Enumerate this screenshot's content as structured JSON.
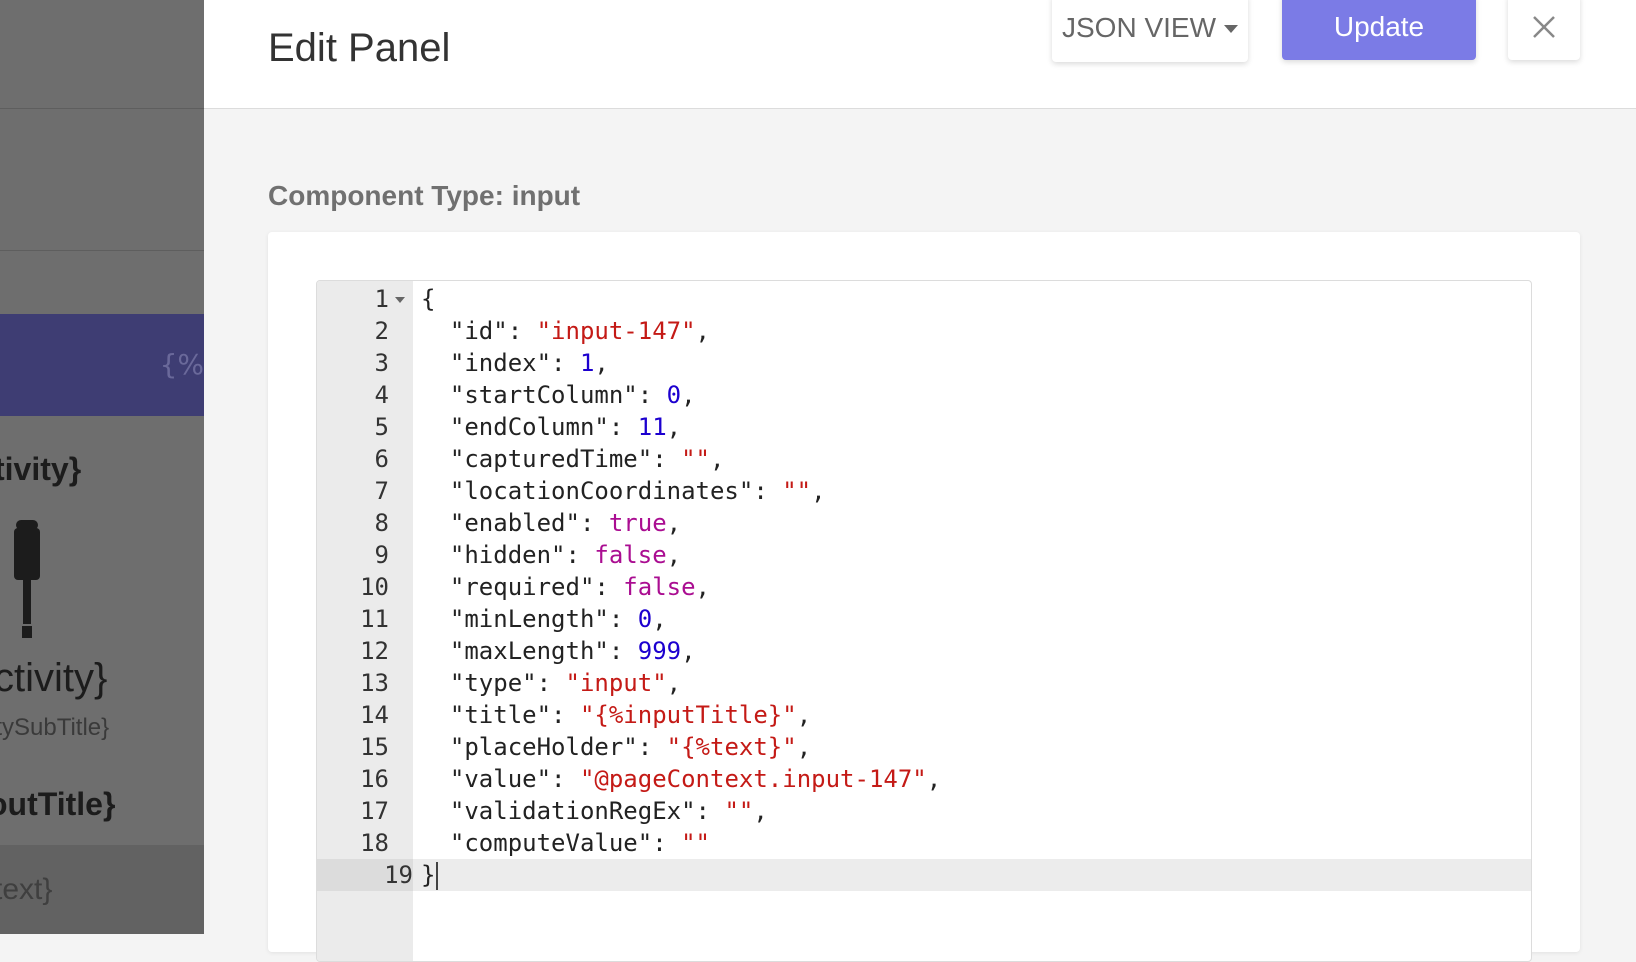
{
  "background": {
    "band_text": "{%",
    "activity_title_bold": "tivity}",
    "activity_title": "ctivity}",
    "activity_subtitle": "itySubTitle}",
    "input_title": "outTitle}",
    "text_field": "text}"
  },
  "header": {
    "title": "Edit Panel",
    "view_dropdown": "JSON VIEW",
    "update_label": "Update",
    "close_icon": "close-icon"
  },
  "main": {
    "component_type_label": "Component Type: input"
  },
  "editor": {
    "line_numbers": [
      "1",
      "2",
      "3",
      "4",
      "5",
      "6",
      "7",
      "8",
      "9",
      "10",
      "11",
      "12",
      "13",
      "14",
      "15",
      "16",
      "17",
      "18",
      "19"
    ],
    "lines": [
      [
        {
          "t": "{",
          "c": "k"
        }
      ],
      [
        {
          "t": "  \"id\": ",
          "c": "k"
        },
        {
          "t": "\"input-147\"",
          "c": "s"
        },
        {
          "t": ",",
          "c": "k"
        }
      ],
      [
        {
          "t": "  \"index\": ",
          "c": "k"
        },
        {
          "t": "1",
          "c": "n"
        },
        {
          "t": ",",
          "c": "k"
        }
      ],
      [
        {
          "t": "  \"startColumn\": ",
          "c": "k"
        },
        {
          "t": "0",
          "c": "n"
        },
        {
          "t": ",",
          "c": "k"
        }
      ],
      [
        {
          "t": "  \"endColumn\": ",
          "c": "k"
        },
        {
          "t": "11",
          "c": "n"
        },
        {
          "t": ",",
          "c": "k"
        }
      ],
      [
        {
          "t": "  \"capturedTime\": ",
          "c": "k"
        },
        {
          "t": "\"\"",
          "c": "s"
        },
        {
          "t": ",",
          "c": "k"
        }
      ],
      [
        {
          "t": "  \"locationCoordinates\": ",
          "c": "k"
        },
        {
          "t": "\"\"",
          "c": "s"
        },
        {
          "t": ",",
          "c": "k"
        }
      ],
      [
        {
          "t": "  \"enabled\": ",
          "c": "k"
        },
        {
          "t": "true",
          "c": "b"
        },
        {
          "t": ",",
          "c": "k"
        }
      ],
      [
        {
          "t": "  \"hidden\": ",
          "c": "k"
        },
        {
          "t": "false",
          "c": "b"
        },
        {
          "t": ",",
          "c": "k"
        }
      ],
      [
        {
          "t": "  \"required\": ",
          "c": "k"
        },
        {
          "t": "false",
          "c": "b"
        },
        {
          "t": ",",
          "c": "k"
        }
      ],
      [
        {
          "t": "  \"minLength\": ",
          "c": "k"
        },
        {
          "t": "0",
          "c": "n"
        },
        {
          "t": ",",
          "c": "k"
        }
      ],
      [
        {
          "t": "  \"maxLength\": ",
          "c": "k"
        },
        {
          "t": "999",
          "c": "n"
        },
        {
          "t": ",",
          "c": "k"
        }
      ],
      [
        {
          "t": "  \"type\": ",
          "c": "k"
        },
        {
          "t": "\"input\"",
          "c": "s"
        },
        {
          "t": ",",
          "c": "k"
        }
      ],
      [
        {
          "t": "  \"title\": ",
          "c": "k"
        },
        {
          "t": "\"{%inputTitle}\"",
          "c": "s"
        },
        {
          "t": ",",
          "c": "k"
        }
      ],
      [
        {
          "t": "  \"placeHolder\": ",
          "c": "k"
        },
        {
          "t": "\"{%text}\"",
          "c": "s"
        },
        {
          "t": ",",
          "c": "k"
        }
      ],
      [
        {
          "t": "  \"value\": ",
          "c": "k"
        },
        {
          "t": "\"@pageContext.input-147\"",
          "c": "s"
        },
        {
          "t": ",",
          "c": "k"
        }
      ],
      [
        {
          "t": "  \"validationRegEx\": ",
          "c": "k"
        },
        {
          "t": "\"\"",
          "c": "s"
        },
        {
          "t": ",",
          "c": "k"
        }
      ],
      [
        {
          "t": "  \"computeValue\": ",
          "c": "k"
        },
        {
          "t": "\"\"",
          "c": "s"
        }
      ],
      [
        {
          "t": "}",
          "c": "k"
        }
      ]
    ],
    "active_line": 19,
    "colors": {
      "string": "#c41a16",
      "number": "#1c00cf",
      "boolean": "#aa0d91"
    }
  }
}
